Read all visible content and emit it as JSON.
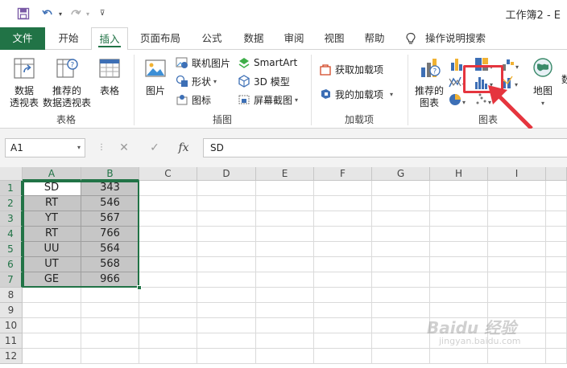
{
  "window": {
    "title": "工作簿2 - E"
  },
  "quick_access": {
    "save_icon": "save-icon",
    "undo_icon": "undo-icon",
    "redo_icon": "redo-icon",
    "customize_icon": "customize-icon"
  },
  "tabs": [
    {
      "label": "文件"
    },
    {
      "label": "开始"
    },
    {
      "label": "插入"
    },
    {
      "label": "页面布局"
    },
    {
      "label": "公式"
    },
    {
      "label": "数据"
    },
    {
      "label": "审阅"
    },
    {
      "label": "视图"
    },
    {
      "label": "帮助"
    },
    {
      "label": "操作说明搜索"
    }
  ],
  "ribbon": {
    "tables": {
      "pivot_line1": "数据",
      "pivot_line2": "透视表",
      "recommended_pivot_line1": "推荐的",
      "recommended_pivot_line2": "数据透视表",
      "table": "表格",
      "group_label": "表格"
    },
    "illustrations": {
      "pictures": "图片",
      "online_pictures": "联机图片",
      "shapes": "形状",
      "icons": "图标",
      "smartart": "SmartArt",
      "model_3d": "3D 模型",
      "screenshot": "屏幕截图",
      "group_label": "插图"
    },
    "addins": {
      "get_addins": "获取加载项",
      "my_addins": "我的加载项",
      "group_label": "加载项"
    },
    "charts": {
      "recommended_line1": "推荐的",
      "recommended_line2": "图表",
      "maps": "地图",
      "pivot_chart_partial": "数",
      "group_label": "图表"
    }
  },
  "formula_bar": {
    "name_box": "A1",
    "fx_label": "fx",
    "content": "SD"
  },
  "grid": {
    "columns": [
      "A",
      "B",
      "C",
      "D",
      "E",
      "F",
      "G",
      "H",
      "I"
    ],
    "rows": [
      "1",
      "2",
      "3",
      "4",
      "5",
      "6",
      "7",
      "8",
      "9",
      "10",
      "11",
      "12"
    ],
    "data": [
      [
        "SD",
        "343"
      ],
      [
        "RT",
        "546"
      ],
      [
        "YT",
        "567"
      ],
      [
        "RT",
        "766"
      ],
      [
        "UU",
        "564"
      ],
      [
        "UT",
        "568"
      ],
      [
        "GE",
        "966"
      ]
    ]
  },
  "watermark": {
    "text": "Baidu 经验",
    "sub": "jingyan.baidu.com"
  },
  "colors": {
    "accent": "#217346",
    "highlight": "#e5353e",
    "selection_fill": "#c6c6c6"
  }
}
